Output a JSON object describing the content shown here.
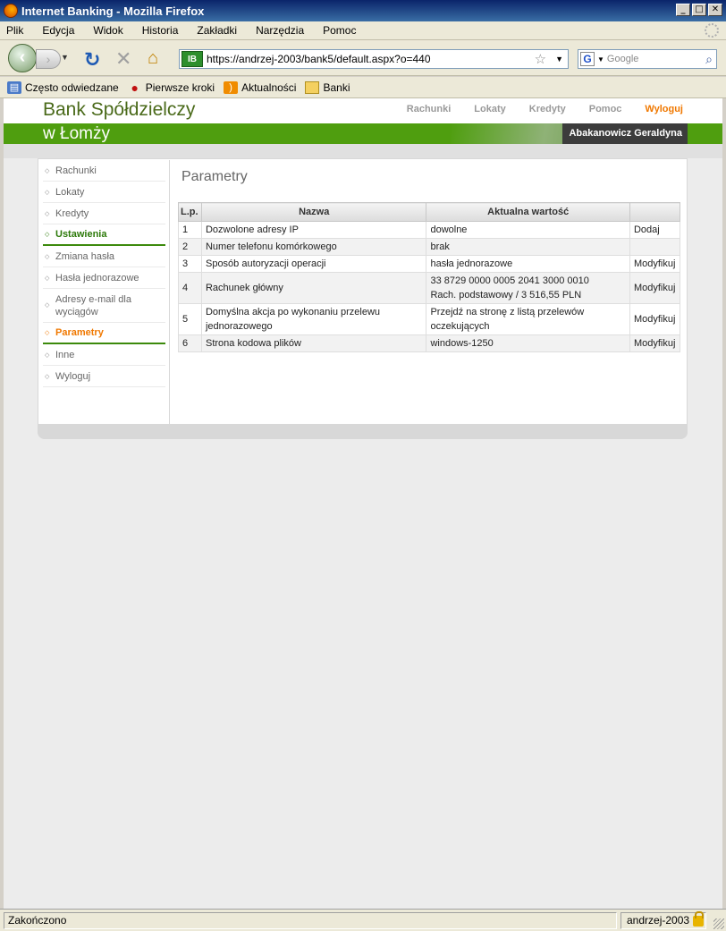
{
  "window": {
    "title": "Internet Banking - Mozilla Firefox",
    "minimize": "_",
    "maximize": "□",
    "close": "✕"
  },
  "menu": [
    "Plik",
    "Edycja",
    "Widok",
    "Historia",
    "Zakładki",
    "Narzędzia",
    "Pomoc"
  ],
  "nav": {
    "url": "https://andrzej-2003/bank5/default.aspx?o=440",
    "site_badge": "IB",
    "search_placeholder": "Google"
  },
  "bookmarks": [
    "Często odwiedzane",
    "Pierwsze kroki",
    "Aktualności",
    "Banki"
  ],
  "bank": {
    "title": "Bank Spółdzielczy",
    "subtitle": "w Łomży",
    "user": "Abakanowicz Geraldyna"
  },
  "topnav": [
    "Rachunki",
    "Lokaty",
    "Kredyty",
    "Pomoc",
    "Wyloguj"
  ],
  "sidebar": [
    {
      "label": "Rachunki"
    },
    {
      "label": "Lokaty"
    },
    {
      "label": "Kredyty"
    },
    {
      "label": "Ustawienia"
    },
    {
      "label": "Zmiana hasła"
    },
    {
      "label": "Hasła jednorazowe"
    },
    {
      "label": "Adresy e-mail dla wyciągów"
    },
    {
      "label": "Parametry"
    },
    {
      "label": "Inne"
    },
    {
      "label": "Wyloguj"
    }
  ],
  "main": {
    "title": "Parametry",
    "columns": [
      "L.p.",
      "Nazwa",
      "Aktualna wartość",
      ""
    ],
    "rows": [
      {
        "lp": "1",
        "name": "Dozwolone adresy IP",
        "value": "dowolne",
        "action": "Dodaj"
      },
      {
        "lp": "2",
        "name": "Numer telefonu komórkowego",
        "value": "brak",
        "action": ""
      },
      {
        "lp": "3",
        "name": "Sposób autoryzacji operacji",
        "value": "hasła jednorazowe",
        "action": "Modyfikuj"
      },
      {
        "lp": "4",
        "name": "Rachunek główny",
        "value": "33 8729 0000 0005 2041 3000 0010",
        "value2": "Rach. podstawowy / 3 516,55 PLN",
        "action": "Modyfikuj"
      },
      {
        "lp": "5",
        "name": "Domyślna akcja po wykonaniu przelewu jednorazowego",
        "value": "Przejdź na stronę z listą przelewów oczekujących",
        "action": "Modyfikuj"
      },
      {
        "lp": "6",
        "name": "Strona kodowa plików",
        "value": "windows-1250",
        "action": "Modyfikuj"
      }
    ]
  },
  "status": {
    "left": "Zakończono",
    "right": "andrzej-2003"
  }
}
